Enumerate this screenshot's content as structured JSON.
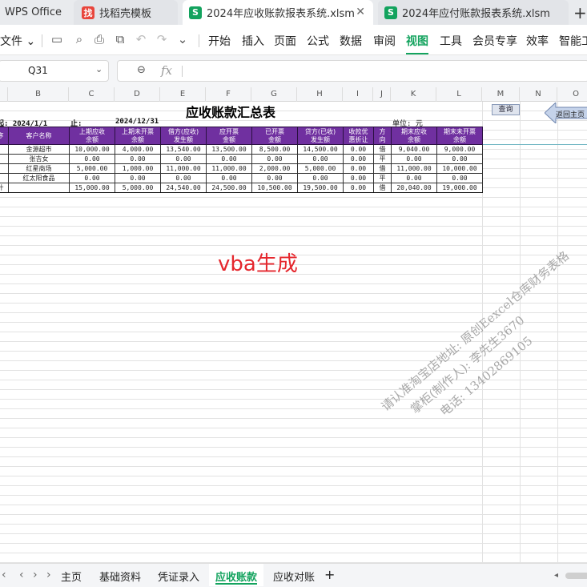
{
  "tabs": {
    "app": "WPS Office",
    "items": [
      {
        "label": "找稻壳模板",
        "icon": "daoke-icon"
      },
      {
        "label": "2024年应收账款报表系统.xlsm",
        "icon": "spreadsheet-icon"
      },
      {
        "label": "2024年应付账款报表系统.xlsm",
        "icon": "spreadsheet-icon"
      }
    ],
    "new_tab": "+"
  },
  "menu": {
    "file": "文件",
    "items": [
      "开始",
      "插入",
      "页面",
      "公式",
      "数据",
      "审阅",
      "视图",
      "工具",
      "会员专享",
      "效率",
      "智能工"
    ],
    "active": "视图"
  },
  "formula_bar": {
    "cell_ref": "Q31",
    "fx": "fx"
  },
  "columns": [
    "B",
    "C",
    "D",
    "E",
    "F",
    "G",
    "H",
    "I",
    "J",
    "K",
    "L",
    "M",
    "N",
    "O"
  ],
  "sheet": {
    "title": "应收账款汇总表",
    "query_button": "查询",
    "home_button": "返回主页",
    "from_label": "起:",
    "from_date": "2024/1/1",
    "to_label": "止:",
    "to_date": "2024/12/31",
    "unit": "单位: 元",
    "headers": [
      "序",
      "客户名称",
      "上期应收\n余额",
      "上期未开票\n余额",
      "借方(应收)\n发生额",
      "应开票\n金额",
      "已开票\n金额",
      "贷方(已收)\n发生额",
      "收款优\n惠折让",
      "方\n向",
      "期末应收\n余额",
      "期末未开票\n余额"
    ],
    "rows": [
      [
        "",
        "金源超市",
        "10,000.00",
        "4,000.00",
        "13,540.00",
        "13,500.00",
        "8,500.00",
        "14,500.00",
        "0.00",
        "借",
        "9,040.00",
        "9,000.00"
      ],
      [
        "",
        "张吉女",
        "0.00",
        "0.00",
        "0.00",
        "0.00",
        "0.00",
        "0.00",
        "0.00",
        "平",
        "0.00",
        "0.00"
      ],
      [
        "",
        "红星商场",
        "5,000.00",
        "1,000.00",
        "11,000.00",
        "11,000.00",
        "2,000.00",
        "5,000.00",
        "0.00",
        "借",
        "11,000.00",
        "10,000.00"
      ],
      [
        "",
        "红太阳食品",
        "0.00",
        "0.00",
        "0.00",
        "0.00",
        "0.00",
        "0.00",
        "0.00",
        "平",
        "0.00",
        "0.00"
      ]
    ],
    "total": [
      "计",
      "",
      "15,000.00",
      "5,000.00",
      "24,540.00",
      "24,500.00",
      "10,500.00",
      "19,500.00",
      "0.00",
      "借",
      "20,040.00",
      "19,000.00"
    ],
    "overlay_text": "vba生成",
    "watermark": [
      "请认准淘宝店地址: 原创Eexcel仓库财务表格",
      "掌柜(制作人): 李先生3670",
      "电话: 13402869105"
    ]
  },
  "sheet_tabs": {
    "items": [
      "主页",
      "基础资料",
      "凭证录入",
      "应收账款",
      "应收对账"
    ],
    "active": "应收账款",
    "add": "+"
  }
}
